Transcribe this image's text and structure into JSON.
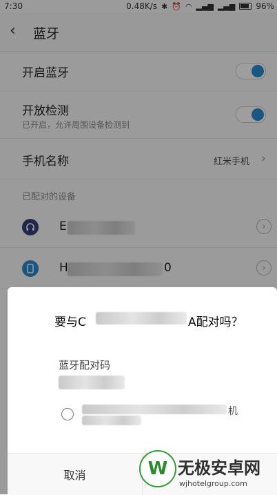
{
  "status_bar": {
    "time": "7:30",
    "speed": "0.48K/s",
    "battery": "96%"
  },
  "header": {
    "title": "蓝牙"
  },
  "settings": {
    "bluetooth": {
      "label": "开启蓝牙",
      "enabled": true
    },
    "visibility": {
      "label": "开放检测",
      "sub": "已开启，允许周围设备检测到",
      "enabled": true
    },
    "device_name": {
      "label": "手机名称",
      "value": "红米手机"
    }
  },
  "paired_section": {
    "label": "已配对的设备"
  },
  "paired_devices": [
    {
      "name_prefix": "E",
      "icon": "headphones-icon"
    },
    {
      "name_prefix": "H",
      "name_suffix": "0",
      "icon": "phone-icon"
    }
  ],
  "dialog": {
    "title_prefix": "要与C",
    "title_suffix": "A配对吗？",
    "pin_label": "蓝牙配对码",
    "option_suffix": "机",
    "cancel_label": "取消"
  },
  "watermark": {
    "title": "无极安卓网",
    "url": "wjhotelgroup.com",
    "logo_letter": "W"
  },
  "colors": {
    "accent": "#2a8bd1",
    "dialog_bg": "#ffffff",
    "overlay": "rgba(0,0,0,0.38)"
  }
}
